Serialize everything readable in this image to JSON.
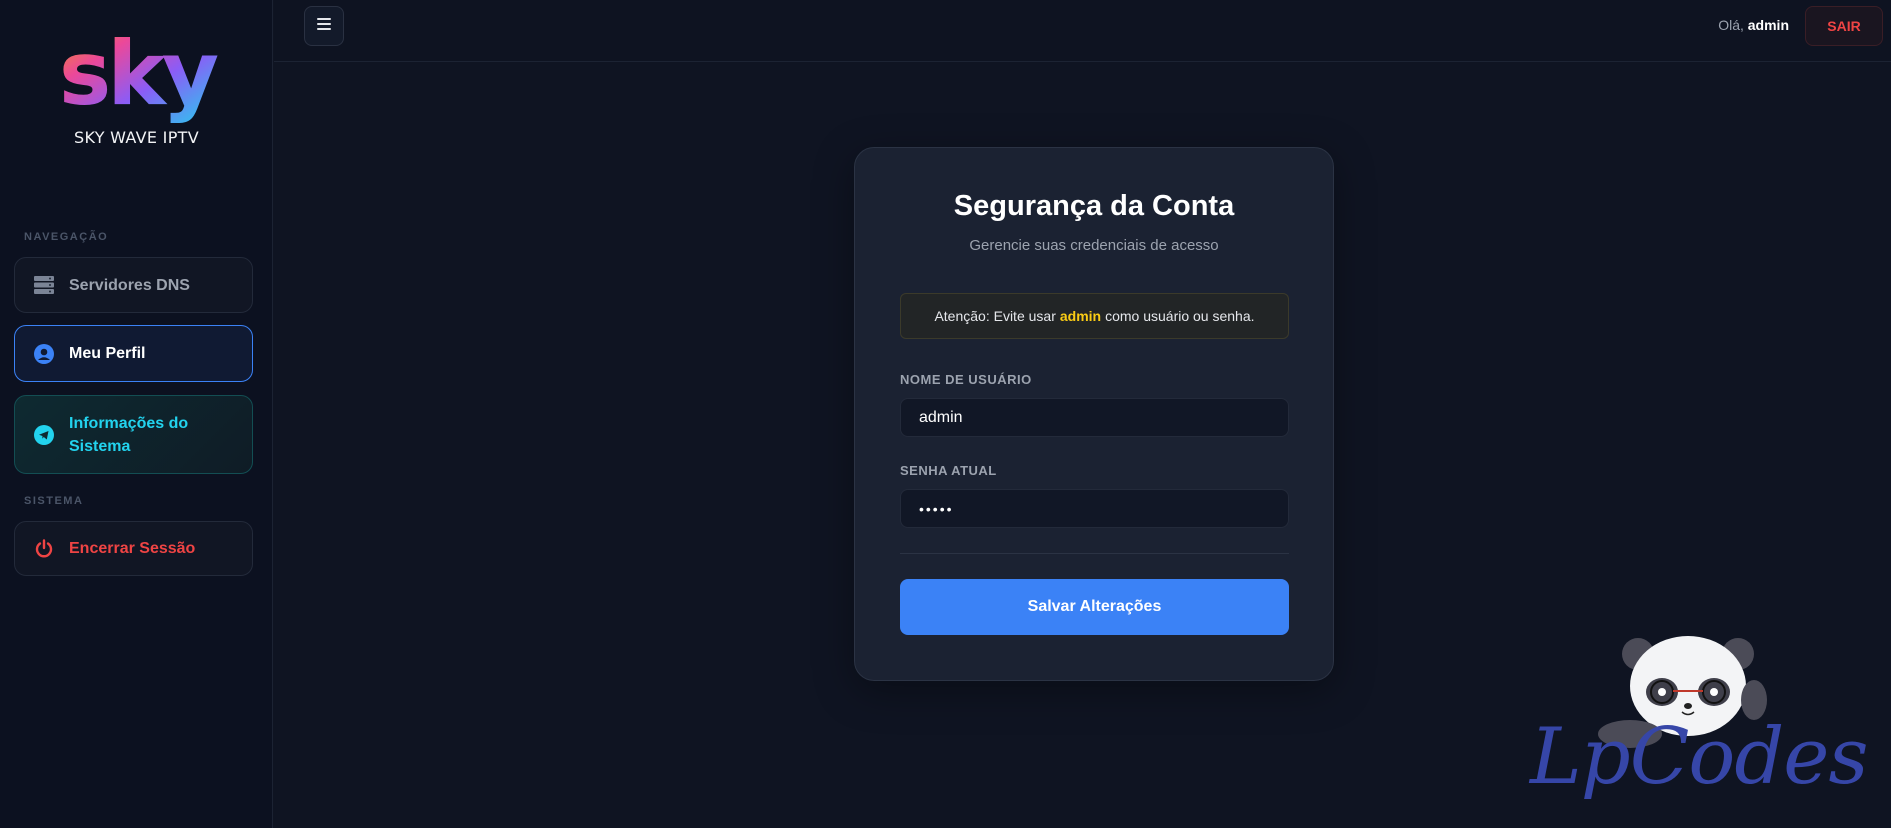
{
  "brand": {
    "name": "SKY WAVE IPTV",
    "logo_text": "sky"
  },
  "sidebar": {
    "sections": {
      "navigation": "NAVEGAÇÃO",
      "system": "SISTEMA"
    },
    "items": [
      {
        "label": "Servidores DNS",
        "icon": "server-icon"
      },
      {
        "label": "Meu Perfil",
        "icon": "user-circle-icon",
        "active": true
      },
      {
        "label": "Informações do Sistema",
        "icon": "telegram-icon"
      },
      {
        "label": "Encerrar Sessão",
        "icon": "power-icon"
      }
    ]
  },
  "topbar": {
    "greeting_prefix": "Olá,",
    "username": "admin",
    "logout_label": "SAIR"
  },
  "card": {
    "title": "Segurança da Conta",
    "subtitle": "Gerencie suas credenciais de acesso",
    "alert": {
      "prefix": "Atenção: Evite usar",
      "highlight": "admin",
      "suffix": "como usuário ou senha."
    },
    "username_label": "NOME DE USUÁRIO",
    "username_value": "admin",
    "password_label": "SENHA ATUAL",
    "password_value": "•••••",
    "save_label": "Salvar Alterações"
  },
  "watermark": {
    "text": "LpCodes"
  },
  "colors": {
    "accent": "#3b82f6",
    "danger": "#ef4444",
    "info": "#22d3ee",
    "warning": "#facc15",
    "background": "#0f1422",
    "card": "#1b2232"
  }
}
